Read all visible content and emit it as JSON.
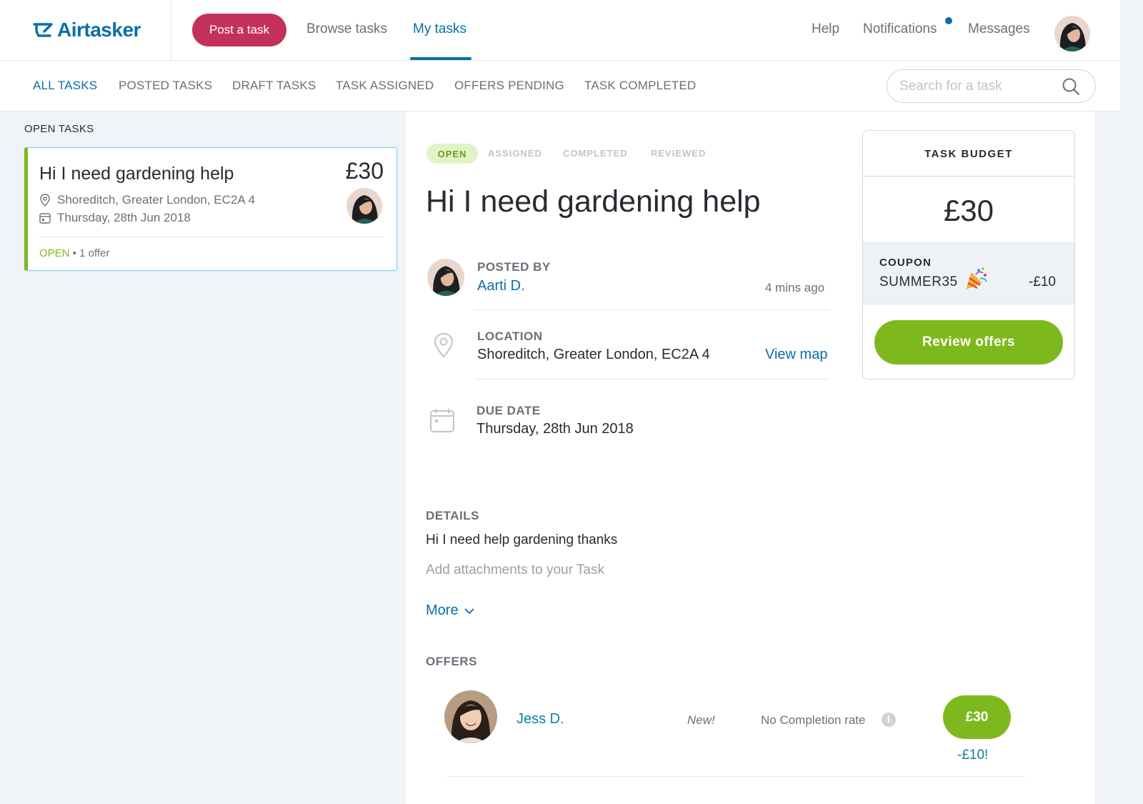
{
  "header": {
    "logo_text": "Airtasker",
    "post_task": "Post a task",
    "nav": {
      "browse": "Browse tasks",
      "my_tasks": "My tasks"
    },
    "right": {
      "help": "Help",
      "notifications": "Notifications",
      "messages": "Messages"
    },
    "accent_color": "#0a6fa6",
    "brand_color": "#c3305c"
  },
  "subnav": {
    "tabs": [
      "ALL TASKS",
      "POSTED TASKS",
      "DRAFT TASKS",
      "TASK ASSIGNED",
      "OFFERS PENDING",
      "TASK COMPLETED"
    ],
    "active_tab": "ALL TASKS",
    "search_placeholder": "Search for a task"
  },
  "sidebar": {
    "section_title": "OPEN TASKS",
    "card": {
      "title": "Hi I need gardening help",
      "price": "£30",
      "location": "Shoreditch, Greater London, EC2A 4",
      "date": "Thursday, 28th Jun 2018",
      "status": "OPEN",
      "offers": "• 1 offer"
    }
  },
  "task": {
    "steps": {
      "open": "OPEN",
      "assigned": "ASSIGNED",
      "completed": "COMPLETED",
      "reviewed": "REVIEWED"
    },
    "current_step": "OPEN",
    "title": "Hi I need gardening help",
    "posted_by_label": "POSTED BY",
    "poster": "Aarti D.",
    "posted_time": "4 mins ago",
    "location_label": "LOCATION",
    "location": "Shoreditch, Greater London, EC2A 4",
    "view_map": "View map",
    "due_label": "DUE DATE",
    "due_date": "Thursday, 28th Jun 2018",
    "details_label": "DETAILS",
    "details_text": "Hi I need help gardening thanks",
    "attachments": "Add attachments to your Task",
    "more": "More"
  },
  "budget": {
    "title": "TASK BUDGET",
    "price": "£30",
    "coupon_label": "COUPON",
    "coupon_code": "SUMMER35",
    "coupon_icon": "party-popper-icon",
    "discount": "-£10",
    "review_button": "Review offers",
    "button_color": "#7db91d"
  },
  "offers": {
    "label": "OFFERS",
    "items": [
      {
        "name": "Jess D.",
        "badge": "New!",
        "completion": "No Completion rate",
        "price": "£30",
        "discount": "-£10!"
      }
    ]
  }
}
